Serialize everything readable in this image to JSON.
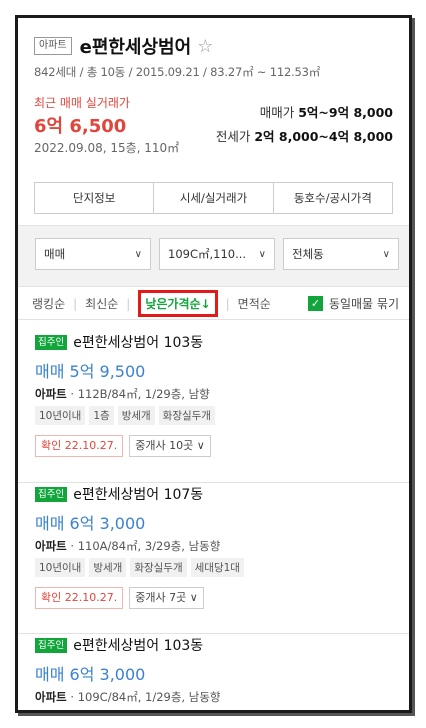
{
  "complex": {
    "type_badge": "아파트",
    "name": "e편한세상범어",
    "meta": "842세대 / 총 10동 / 2015.09.21 / 83.27㎡ ~ 112.53㎡",
    "recent_label": "최근 매매 실거래가",
    "recent_price": "6억 6,500",
    "recent_date": "2022.09.08, 15층, 110㎡",
    "sale_range_label": "매매가",
    "sale_range_value": "5억~9억 8,000",
    "jeonse_range_label": "전세가",
    "jeonse_range_value": "2억 8,000~4억 8,000"
  },
  "tabs": [
    "단지정보",
    "시세/실거래가",
    "동호수/공시가격"
  ],
  "filters": {
    "trade_type": "매매",
    "area": "109C㎡,110...",
    "building": "전체동"
  },
  "sort": {
    "items": [
      "랭킹순",
      "최신순",
      "낮은가격순↓",
      "면적순"
    ],
    "dedupe_label": "동일매물 묶기"
  },
  "listings": [
    {
      "badge": "집주인",
      "name": "e편한세상범어 103동",
      "price": "매매 5억 9,500",
      "type": "아파트",
      "desc": "112B/84㎡, 1/29층, 남향",
      "tags": [
        "10년이내",
        "1층",
        "방세개",
        "화장실두개"
      ],
      "verified": "확인 22.10.27.",
      "agents": "중개사 10곳"
    },
    {
      "badge": "집주인",
      "name": "e편한세상범어 107동",
      "price": "매매 6억 3,000",
      "type": "아파트",
      "desc": "110A/84㎡, 3/29층, 남동향",
      "tags": [
        "10년이내",
        "방세개",
        "화장실두개",
        "세대당1대"
      ],
      "verified": "확인 22.10.27.",
      "agents": "중개사 7곳"
    },
    {
      "badge": "집주인",
      "name": "e편한세상범어 103동",
      "price": "매매 6억 3,000",
      "type": "아파트",
      "desc": "109C/84㎡, 1/29층, 남동향"
    }
  ],
  "colors": {
    "accent_green": "#11a53b",
    "price_blue": "#3b82d1",
    "recent_red": "#e0463c",
    "highlight_red": "#e21a1a"
  }
}
